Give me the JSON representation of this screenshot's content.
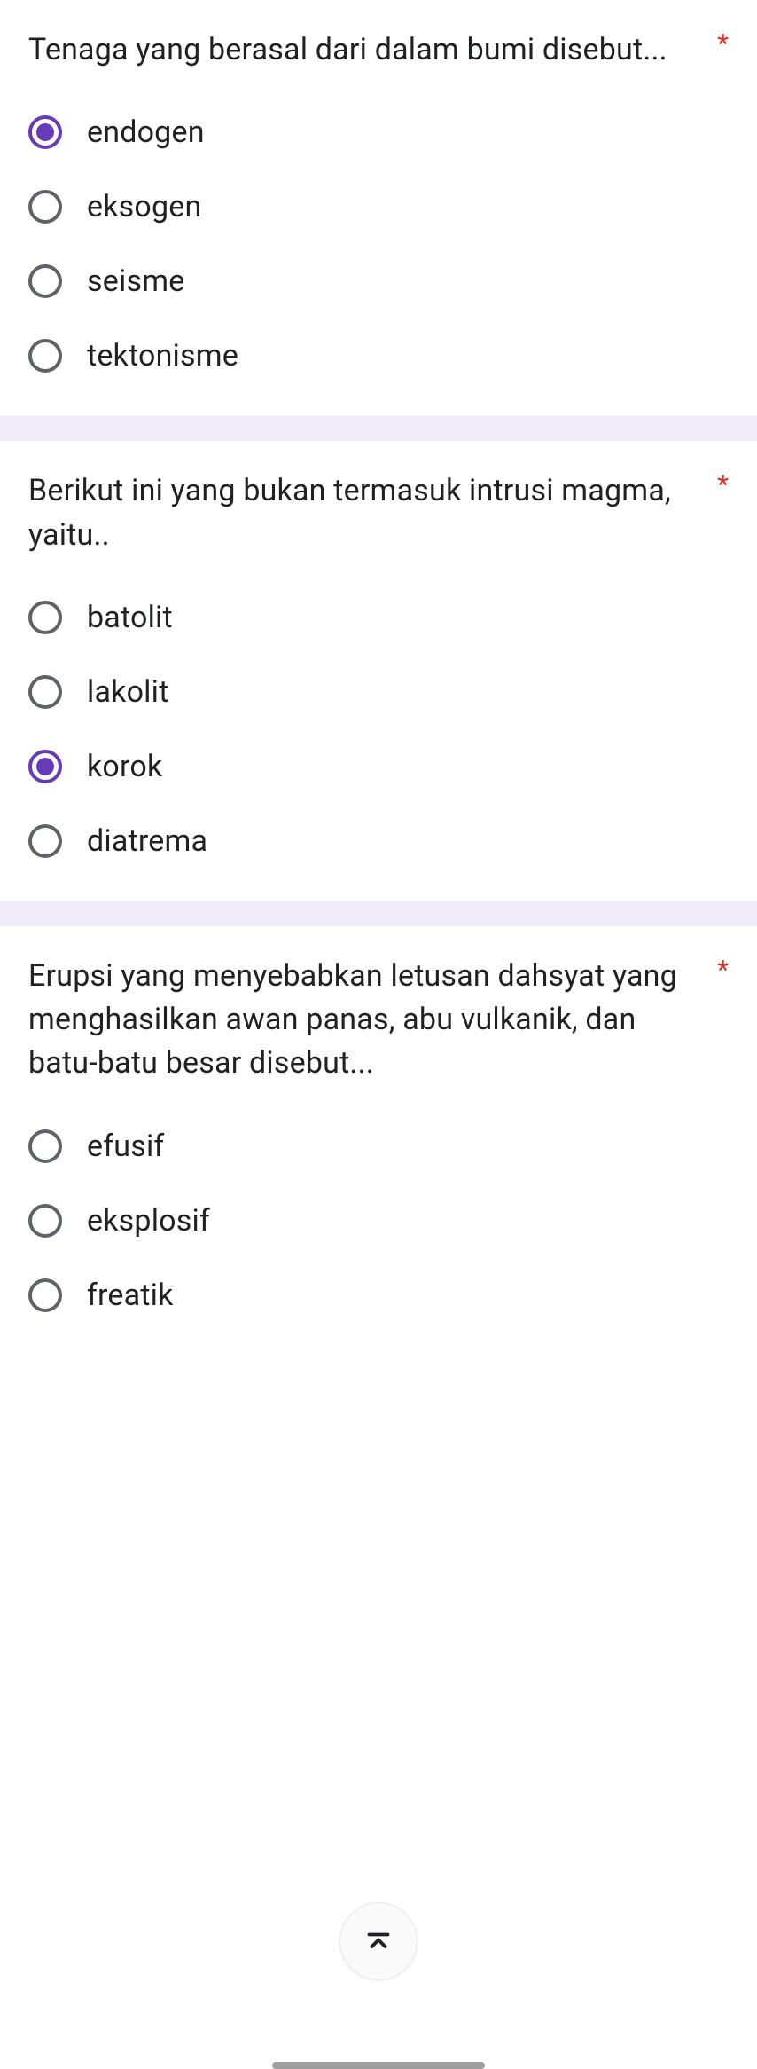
{
  "questions": [
    {
      "text": "Tenaga yang berasal dari dalam bumi disebut...",
      "required": "*",
      "options": [
        {
          "label": "endogen",
          "selected": true
        },
        {
          "label": "eksogen",
          "selected": false
        },
        {
          "label": "seisme",
          "selected": false
        },
        {
          "label": "tektonisme",
          "selected": false
        }
      ]
    },
    {
      "text": "Berikut ini yang bukan termasuk intrusi magma, yaitu..",
      "required": "*",
      "options": [
        {
          "label": "batolit",
          "selected": false
        },
        {
          "label": "lakolit",
          "selected": false
        },
        {
          "label": "korok",
          "selected": true
        },
        {
          "label": "diatrema",
          "selected": false
        }
      ]
    },
    {
      "text": "Erupsi yang menyebabkan letusan dahsyat yang menghasilkan awan panas, abu vulkanik, dan batu-batu besar disebut...",
      "required": "*",
      "options": [
        {
          "label": "efusif",
          "selected": false
        },
        {
          "label": "eksplosif",
          "selected": false
        },
        {
          "label": "freatik",
          "selected": false
        }
      ]
    }
  ]
}
